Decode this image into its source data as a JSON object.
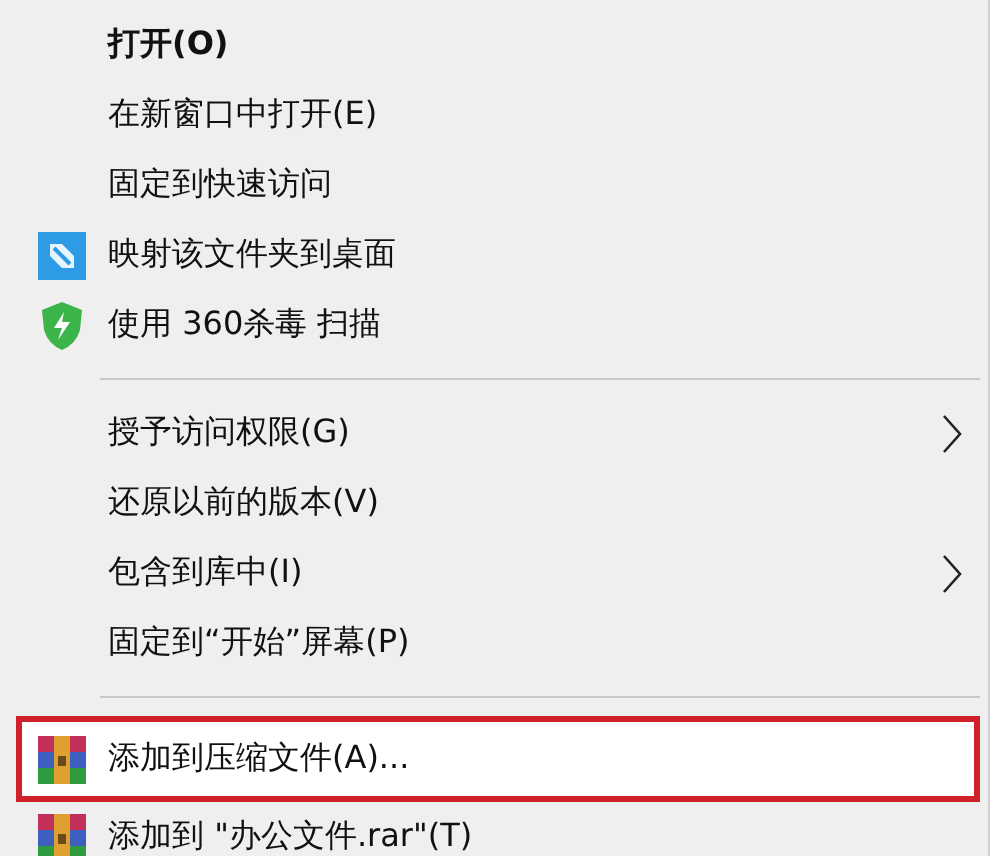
{
  "menu": {
    "items": [
      {
        "kind": "plain",
        "label": "打开(O)",
        "bold": true,
        "selected": false
      },
      {
        "kind": "plain",
        "label": "在新窗口中打开(E)",
        "selected": false
      },
      {
        "kind": "plain",
        "label": "固定到快速访问",
        "selected": false
      },
      {
        "kind": "desktop",
        "label": "映射该文件夹到桌面",
        "selected": false
      },
      {
        "kind": "antivirus",
        "label": "使用 360杀毒 扫描",
        "selected": false
      },
      {
        "kind": "separator"
      },
      {
        "kind": "plain",
        "label": "授予访问权限(G)",
        "submenu": true,
        "selected": false
      },
      {
        "kind": "plain",
        "label": "还原以前的版本(V)",
        "selected": false
      },
      {
        "kind": "plain",
        "label": "包含到库中(I)",
        "submenu": true,
        "selected": false
      },
      {
        "kind": "plain",
        "label": "固定到“开始”屏幕(P)",
        "selected": false
      },
      {
        "kind": "separator"
      },
      {
        "kind": "archive",
        "label": "添加到压缩文件(A)...",
        "selected": true
      },
      {
        "kind": "archive",
        "label": "添加到 \"办公文件.rar\"(T)",
        "selected": false
      }
    ]
  }
}
